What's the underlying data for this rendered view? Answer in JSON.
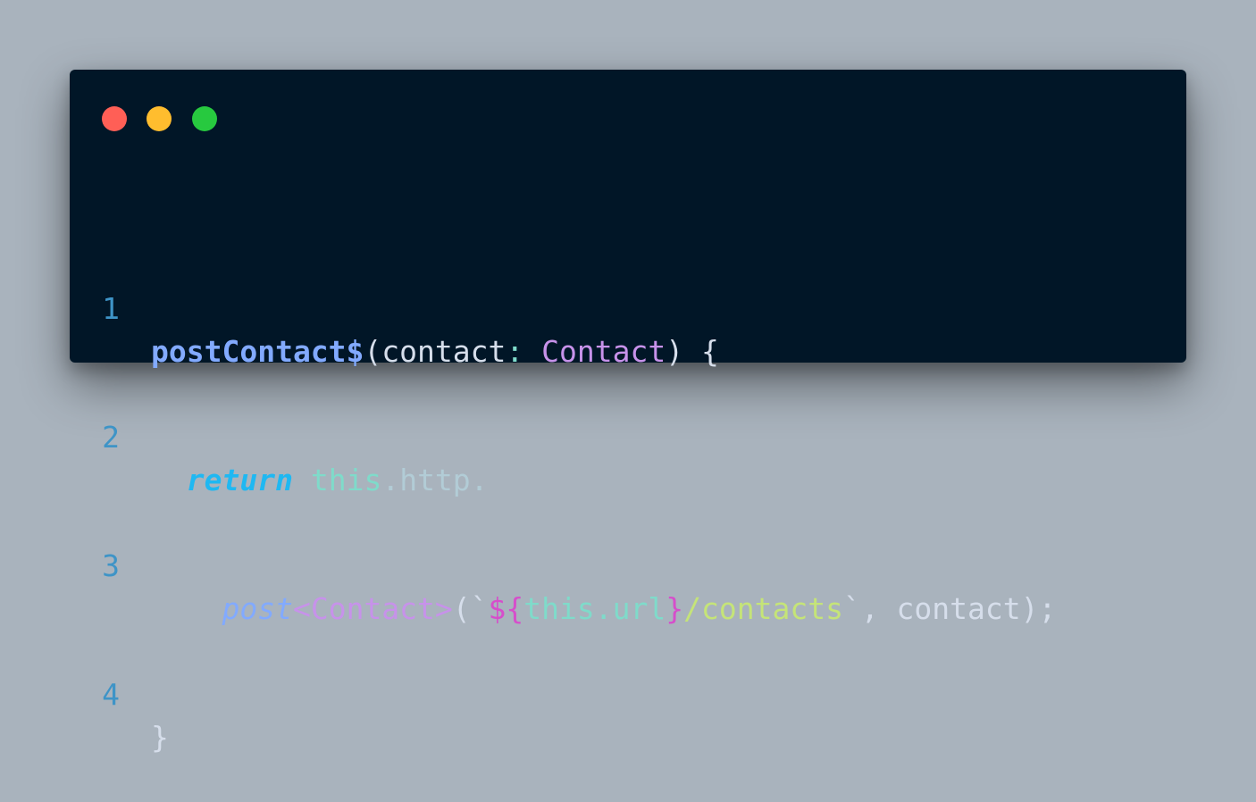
{
  "window": {
    "controls": [
      {
        "name": "close",
        "color": "#ff5f56"
      },
      {
        "name": "minimize",
        "color": "#ffbd2e"
      },
      {
        "name": "maximize",
        "color": "#27c93f"
      }
    ]
  },
  "code": {
    "lines": [
      {
        "number": "1",
        "tokens": [
          "postContact$",
          "(",
          "contact",
          ":",
          " Contact",
          ") {"
        ]
      },
      {
        "number": "2",
        "tokens": [
          "  ",
          "return",
          " ",
          "this",
          ".http."
        ]
      },
      {
        "number": "3",
        "tokens": [
          "    ",
          "post",
          "<Contact>",
          "(`",
          "${",
          "this",
          ".url",
          "}",
          "/contacts",
          "`",
          ", contact);"
        ]
      },
      {
        "number": "4",
        "tokens": [
          "}"
        ]
      }
    ]
  }
}
